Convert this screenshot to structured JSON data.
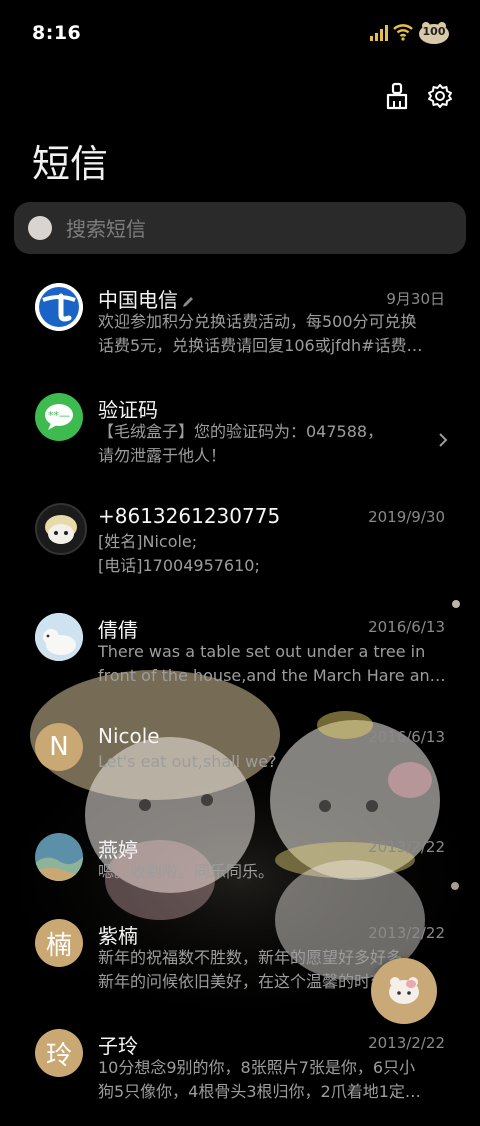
{
  "status_bar": {
    "time": "8:16",
    "battery_level": "100"
  },
  "header": {
    "title": "短信"
  },
  "search": {
    "placeholder": "搜索短信"
  },
  "conversations": [
    {
      "sender": "中国电信",
      "date": "9月30日",
      "avatar": "china-telecom-logo",
      "line1": "欢迎参加积分兑换话费活动，每500分可兑换",
      "line2": "话费5元，兑换话费请回复106或jfdh#话费…"
    },
    {
      "sender": "验证码",
      "date": "",
      "avatar": "message-bubble-icon",
      "line1": "【毛绒盒子】您的验证码为：047588，",
      "line2": "请勿泄露于他人！"
    },
    {
      "sender": "+8613261230775",
      "date": "2019/9/30",
      "avatar": "plush-toy-photo",
      "line1": "[姓名]Nicole;",
      "line2": "[电话]17004957610;"
    },
    {
      "sender": "倩倩",
      "date": "2016/6/13",
      "avatar": "polar-bear-photo",
      "line1": "There was a table set out under a tree in",
      "line2": "front of the house,and the March Hare an…"
    },
    {
      "sender": "Nicole",
      "date": "2016/6/13",
      "avatar_letter": "N",
      "line1": "Let's eat out,shall we?",
      "line2": ""
    },
    {
      "sender": "燕婷",
      "date": "2013/2/22",
      "avatar": "landscape-photo",
      "line1": "嗯。收到啦。同乐同乐。",
      "line2": ""
    },
    {
      "sender": "紫楠",
      "date": "2013/2/22",
      "avatar_letter": "楠",
      "line1": "新年的祝福数不胜数，新年的愿望好多好多，",
      "line2": "新年的问候依旧美好，在这个温馨的时刻…"
    },
    {
      "sender": "子玲",
      "date": "2013/2/22",
      "avatar_letter": "玲",
      "line1": "10分想念9别的你，8张照片7张是你，6只小",
      "line2": "狗5只像你，4根骨头3根归你，2爪着地1定…"
    }
  ],
  "colors": {
    "accent": "#c8a977",
    "telecom_blue": "#1a64c8",
    "verify_green": "#3dbb4e"
  }
}
